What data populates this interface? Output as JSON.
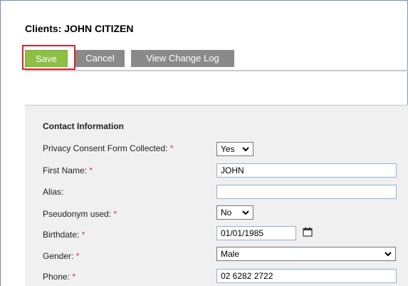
{
  "header": {
    "title": "Clients: JOHN CITIZEN"
  },
  "toolbar": {
    "save_label": "Save",
    "cancel_label": "Cancel",
    "change_log_label": "View Change Log"
  },
  "form": {
    "section_title": "Contact Information",
    "required_marker": "*",
    "privacy_consent": {
      "label": "Privacy Consent Form Collected:",
      "value": "Yes"
    },
    "first_name": {
      "label": "First Name:",
      "value": "JOHN"
    },
    "alias": {
      "label": "Alias:",
      "value": ""
    },
    "pseudonym": {
      "label": "Pseudonym used:",
      "value": "No"
    },
    "birthdate": {
      "label": "Birthdate:",
      "value": "01/01/1985"
    },
    "gender": {
      "label": "Gender:",
      "value": "Male"
    },
    "phone": {
      "label": "Phone:",
      "value": "02 6282 2722"
    }
  },
  "colors": {
    "save_button": "#8cbf44",
    "secondary_button": "#8a8a8a",
    "highlight_box": "#d9232f",
    "panel_background": "#f0f0f0",
    "required_star": "#d33333"
  },
  "icons": {
    "birthdate_picker": "calendar-icon",
    "select_arrow": "chevron-down-icon"
  }
}
